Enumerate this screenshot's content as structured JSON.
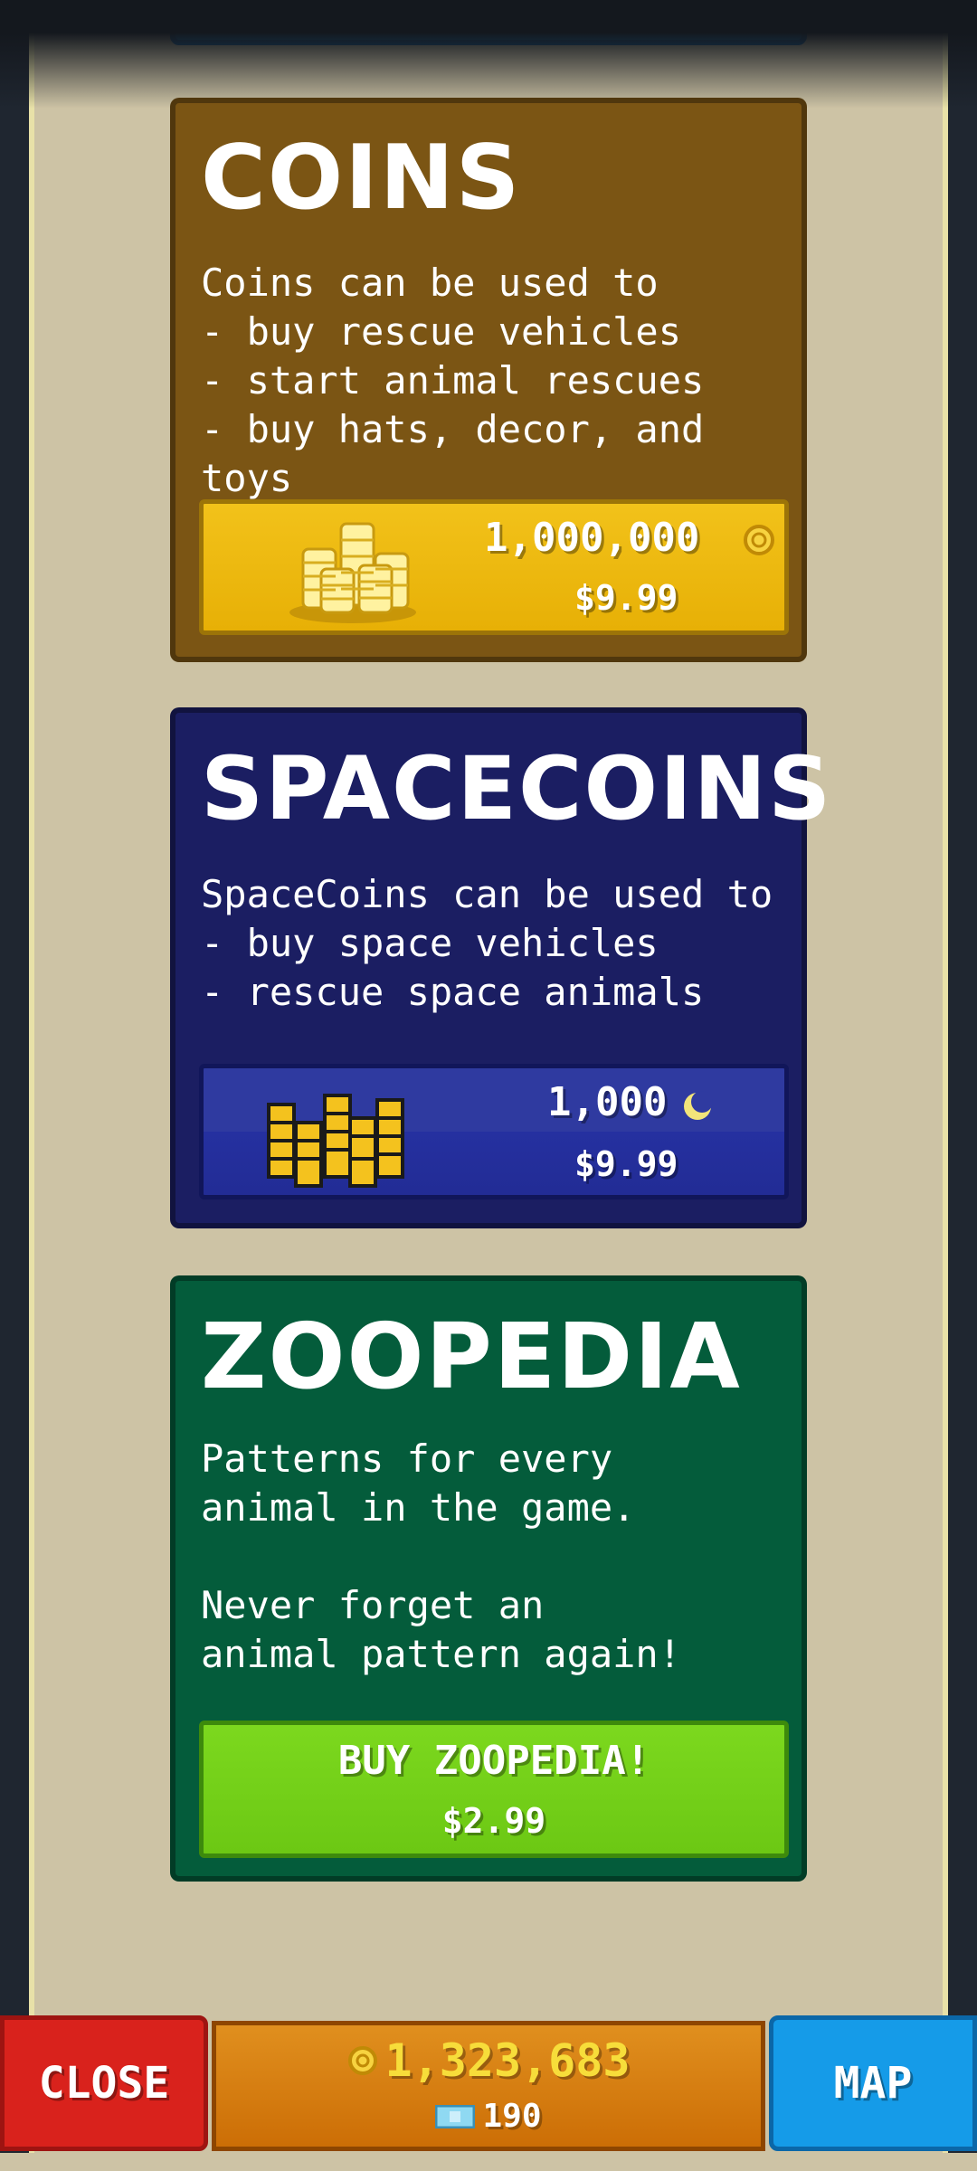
{
  "coins_card": {
    "title": "COINS",
    "description": "Coins can be used to\n- buy rescue vehicles\n- start animal rescues\n- buy hats, decor, and toys",
    "amount": "1,000,000",
    "price": "$9.99",
    "icon": "gold-coin-icon",
    "color": "#7b5514"
  },
  "spacecoins_card": {
    "title": "SPACECOINS",
    "description": "SpaceCoins can be used to\n- buy space vehicles\n- rescue space animals",
    "amount": "1,000",
    "price": "$9.99",
    "icon": "spacecoin-icon",
    "color": "#1b1e62"
  },
  "zoopedia_card": {
    "title": "ZOOPEDIA",
    "description": "Patterns for every\nanimal in the game.\n\nNever forget an\nanimal pattern again!",
    "button_label": "BUY ZOOPEDIA!",
    "price": "$2.99",
    "color": "#045c3b"
  },
  "bottom_bar": {
    "close_label": "CLOSE",
    "coins_balance": "1,323,683",
    "cash_balance": "190",
    "map_label": "MAP"
  }
}
